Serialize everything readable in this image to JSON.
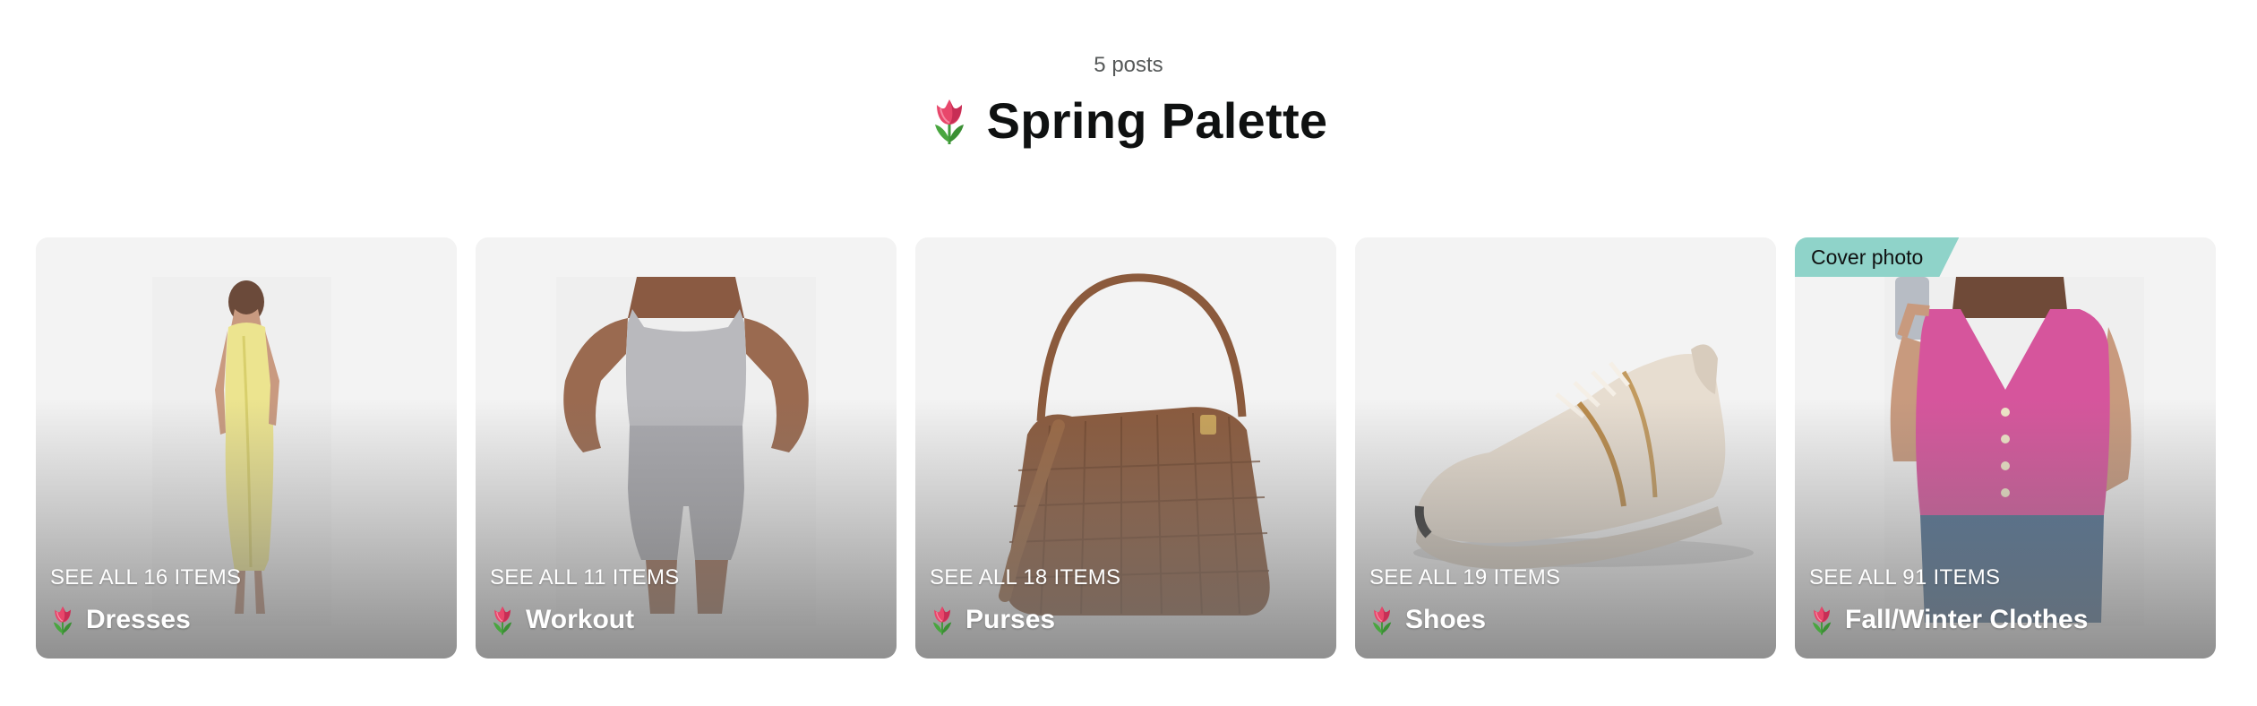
{
  "header": {
    "post_count": "5 posts",
    "title": "Spring Palette",
    "title_icon": "tulip-icon"
  },
  "colors": {
    "badge": "#8fd3c9",
    "text": "#0f1111",
    "card_bg": "#f3f3f3"
  },
  "cards": [
    {
      "see_all": "SEE ALL 16 ITEMS",
      "title": "Dresses",
      "icon": "tulip-icon",
      "image": "yellow-dress-model"
    },
    {
      "see_all": "SEE ALL 11 ITEMS",
      "title": "Workout",
      "icon": "tulip-icon",
      "image": "grey-workout-set-model"
    },
    {
      "see_all": "SEE ALL 18 ITEMS",
      "title": "Purses",
      "icon": "tulip-icon",
      "image": "brown-woven-hobo-bag"
    },
    {
      "see_all": "SEE ALL 19 ITEMS",
      "title": "Shoes",
      "icon": "tulip-icon",
      "image": "beige-running-sneaker"
    },
    {
      "see_all": "SEE ALL 91 ITEMS",
      "title": "Fall/Winter Clothes",
      "icon": "tulip-icon",
      "image": "pink-knit-vest-model",
      "badge": "Cover photo"
    }
  ]
}
